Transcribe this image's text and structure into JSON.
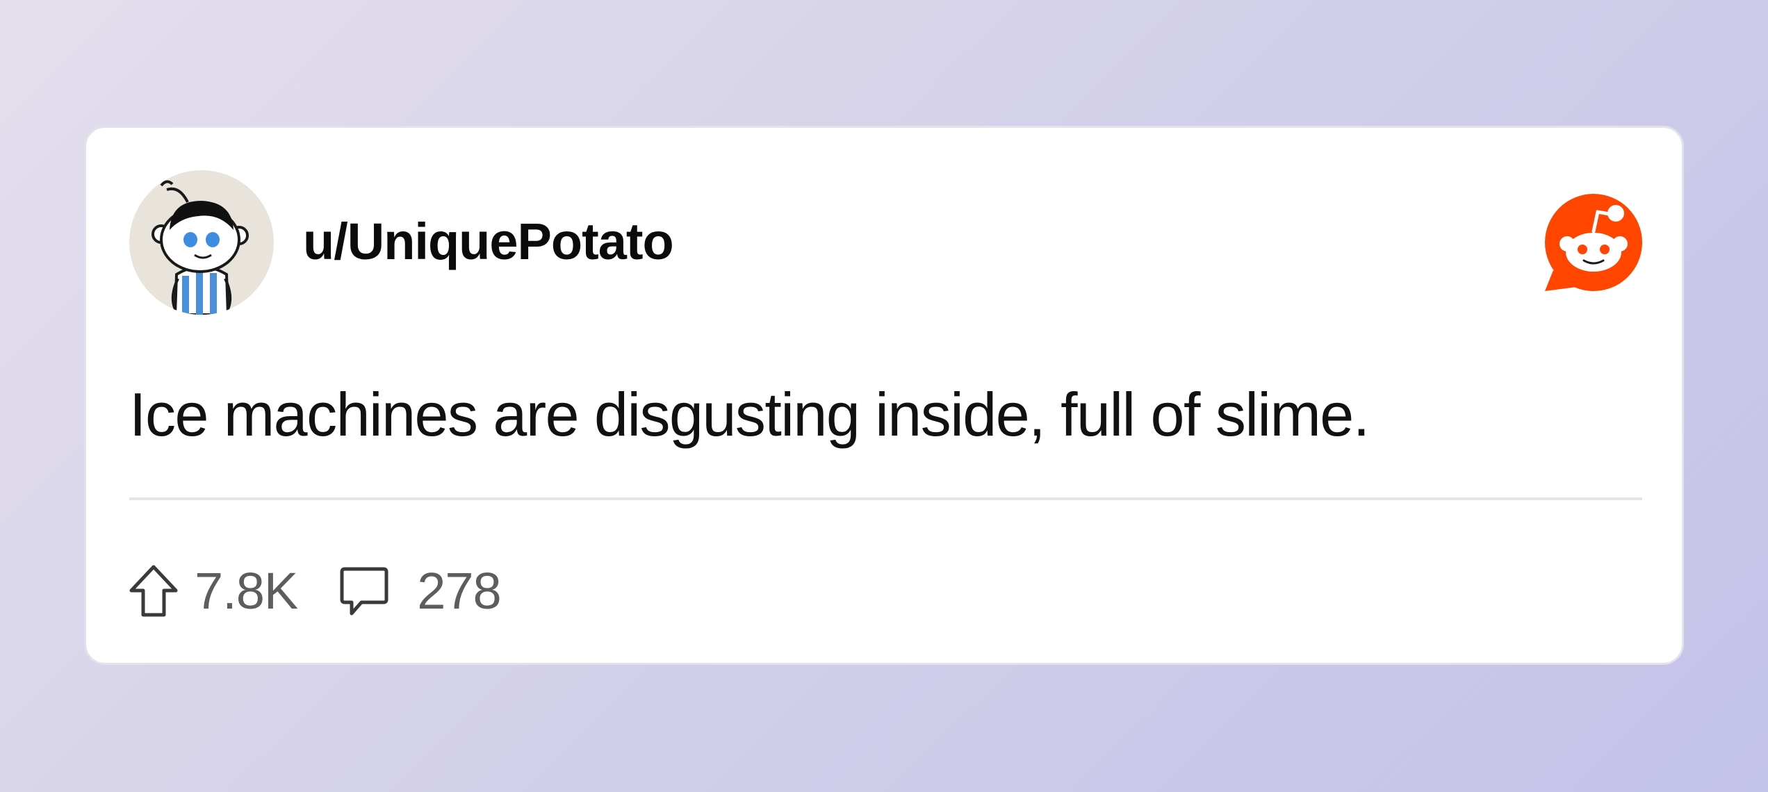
{
  "post": {
    "username": "u/UniquePotato",
    "text": "Ice machines are disgusting inside, full of slime.",
    "upvotes": "7.8K",
    "comments": "278"
  },
  "icons": {
    "avatar": "snoo-avatar",
    "brand": "reddit-logo-icon",
    "upvote": "upvote-arrow-icon",
    "comment": "comment-bubble-icon"
  },
  "colors": {
    "brand": "#ff4500",
    "card_background": "#ffffff",
    "text_primary": "#111111",
    "text_secondary": "#5d5d5d",
    "divider": "#e5e5e8"
  }
}
